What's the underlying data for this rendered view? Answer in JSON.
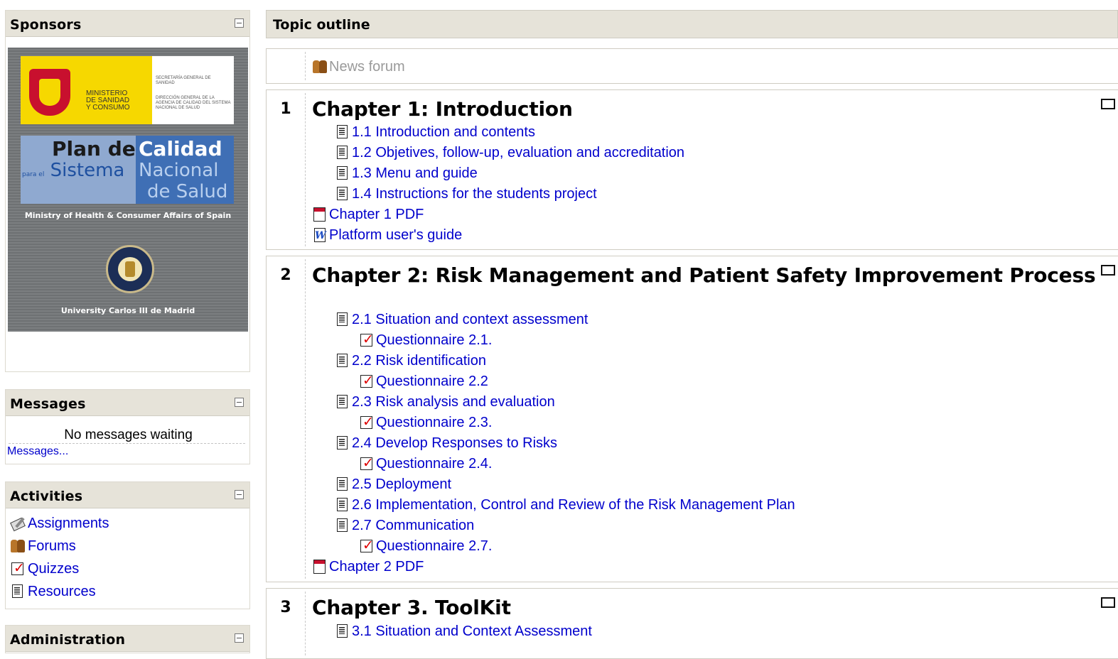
{
  "sponsors": {
    "title": "Sponsors",
    "ministry_line1": "MINISTERIO",
    "ministry_line2": "DE SANIDAD",
    "ministry_line3": "Y CONSUMO",
    "secretaria": "SECRETARÍA GENERAL DE SANIDAD",
    "direccion": "DIRECCIÓN GENERAL DE LA AGENCIA DE CALIDAD DEL SISTEMA NACIONAL DE SALUD",
    "plan_1": "Plan de",
    "plan_2": "Calidad",
    "plan_3_small": "para el",
    "plan_3": "Sistema",
    "plan_4": "Nacional",
    "plan_5": "de Salud",
    "ministry_en": "Ministry of Health & Consumer Affairs of Spain",
    "university": "University Carlos III de Madrid"
  },
  "messages": {
    "title": "Messages",
    "empty_text": "No messages waiting",
    "link": "Messages..."
  },
  "activities": {
    "title": "Activities",
    "items": [
      {
        "label": "Assignments",
        "icon": "assignment-icon"
      },
      {
        "label": "Forums",
        "icon": "forum-icon"
      },
      {
        "label": "Quizzes",
        "icon": "quiz-icon"
      },
      {
        "label": "Resources",
        "icon": "resource-icon"
      }
    ]
  },
  "administration": {
    "title": "Administration"
  },
  "outline": {
    "title": "Topic outline",
    "news_forum": "News forum",
    "sections": [
      {
        "number": "1",
        "title": "Chapter 1: Introduction",
        "items": [
          {
            "label": "1.1 Introduction and contents",
            "icon": "resource-icon"
          },
          {
            "label": "1.2 Objetives, follow-up, evaluation and accreditation",
            "icon": "resource-icon"
          },
          {
            "label": "1.3 Menu and guide",
            "icon": "resource-icon"
          },
          {
            "label": "1.4 Instructions for the students project",
            "icon": "resource-icon"
          },
          {
            "label": "Chapter 1 PDF",
            "icon": "pdf-icon"
          },
          {
            "label": "Platform user's guide",
            "icon": "word-icon"
          }
        ]
      },
      {
        "number": "2",
        "title": "Chapter 2: Risk Management and Patient Safety Improvement Process",
        "items": [
          {
            "label": "2.1 Situation and context assessment",
            "icon": "resource-icon"
          },
          {
            "label": "Questionnaire 2.1.",
            "icon": "quiz-icon"
          },
          {
            "label": "2.2 Risk identification",
            "icon": "resource-icon"
          },
          {
            "label": "Questionnaire 2.2",
            "icon": "quiz-icon"
          },
          {
            "label": "2.3 Risk analysis and evaluation",
            "icon": "resource-icon"
          },
          {
            "label": "Questionnaire 2.3.",
            "icon": "quiz-icon"
          },
          {
            "label": "2.4 Develop Responses to Risks",
            "icon": "resource-icon"
          },
          {
            "label": "Questionnaire 2.4.",
            "icon": "quiz-icon"
          },
          {
            "label": "2.5 Deployment",
            "icon": "resource-icon"
          },
          {
            "label": "2.6 Implementation, Control and Review of the Risk Management Plan",
            "icon": "resource-icon"
          },
          {
            "label": "2.7 Communication",
            "icon": "resource-icon"
          },
          {
            "label": "Questionnaire 2.7.",
            "icon": "quiz-icon"
          },
          {
            "label": "Chapter 2 PDF",
            "icon": "pdf-icon"
          }
        ]
      },
      {
        "number": "3",
        "title": "Chapter 3. ToolKit",
        "items": [
          {
            "label": "3.1 Situation and Context Assessment",
            "icon": "resource-icon"
          }
        ]
      }
    ]
  }
}
